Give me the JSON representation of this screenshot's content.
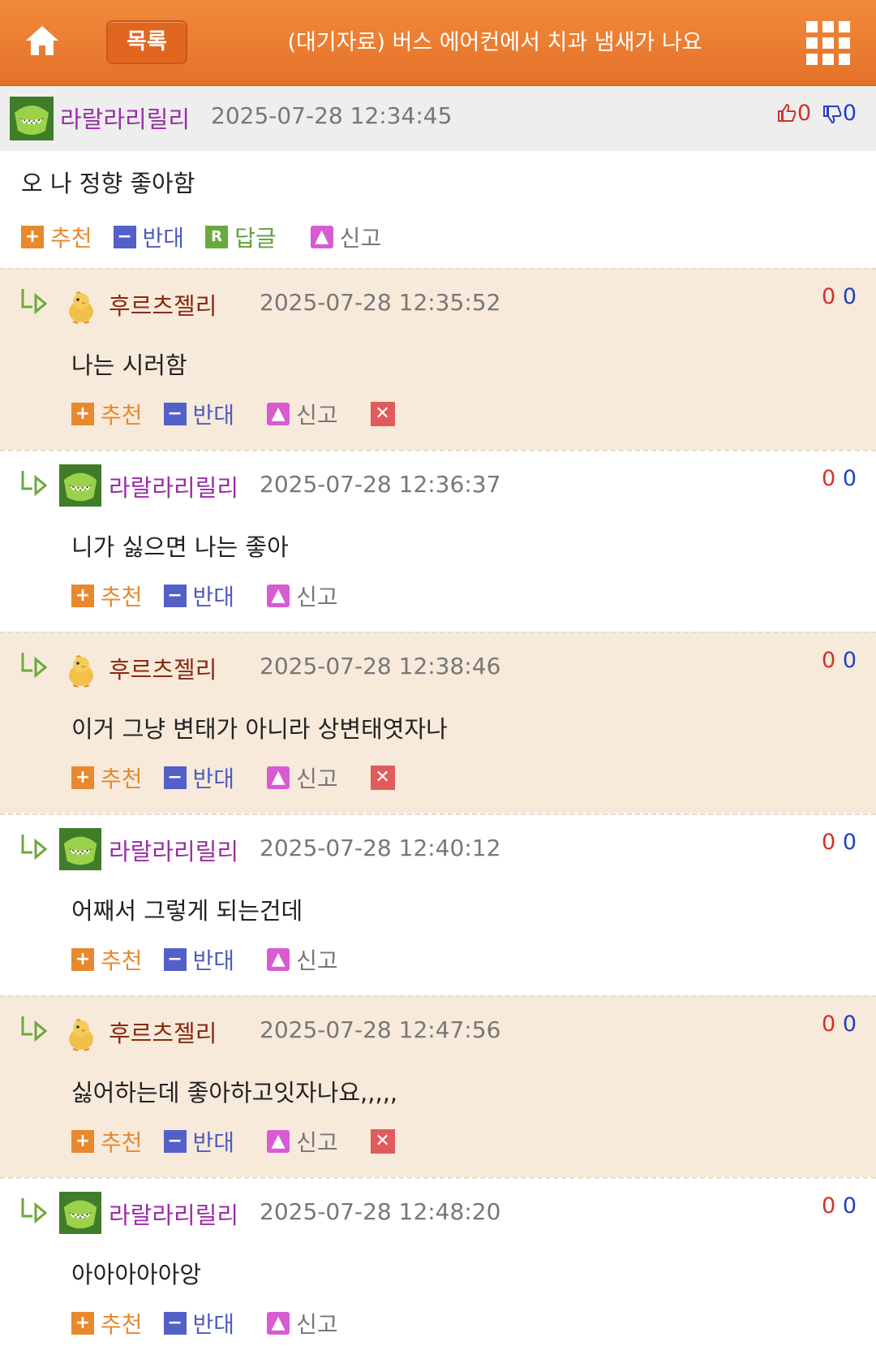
{
  "header": {
    "home_icon": "home-icon",
    "list_label": "목록",
    "title": "(대기자료) 버스 에어컨에서 치과 냄새가 나요",
    "menu_icon": "grid-menu-icon"
  },
  "post": {
    "nickname": "라랄라리릴리",
    "time": "2025-07-28 12:34:45",
    "upvotes": "0",
    "downvotes": "0",
    "text": "오 나 정향 좋아함",
    "actions": {
      "recommend": "추천",
      "oppose": "반대",
      "reply": "답글",
      "report": "신고"
    }
  },
  "comments": [
    {
      "nickname": "후르츠젤리",
      "time": "2025-07-28 12:35:52",
      "up": "0",
      "down": "0",
      "text": "나는 시러함",
      "style": "chick",
      "deletable": true
    },
    {
      "nickname": "라랄라리릴리",
      "time": "2025-07-28 12:36:37",
      "up": "0",
      "down": "0",
      "text": "니가 싫으면 나는 좋아",
      "style": "monster",
      "deletable": false
    },
    {
      "nickname": "후르츠젤리",
      "time": "2025-07-28 12:38:46",
      "up": "0",
      "down": "0",
      "text": "이거 그냥 변태가 아니라 상변태엿자나",
      "style": "chick",
      "deletable": true
    },
    {
      "nickname": "라랄라리릴리",
      "time": "2025-07-28 12:40:12",
      "up": "0",
      "down": "0",
      "text": "어째서 그렇게 되는건데",
      "style": "monster",
      "deletable": false
    },
    {
      "nickname": "후르츠젤리",
      "time": "2025-07-28 12:47:56",
      "up": "0",
      "down": "0",
      "text": "싫어하는데 좋아하고잇자나요,,,,,",
      "style": "chick",
      "deletable": true
    },
    {
      "nickname": "라랄라리릴리",
      "time": "2025-07-28 12:48:20",
      "up": "0",
      "down": "0",
      "text": "아아아아아앙",
      "style": "monster",
      "deletable": false
    }
  ],
  "comment_actions": {
    "recommend": "추천",
    "oppose": "반대",
    "report": "신고"
  },
  "colors": {
    "header_orange": "#e8782e",
    "comment_tan": "#f7eadb",
    "nick_purple": "#9b2ca8",
    "nick_brown": "#8a2a10",
    "vote_red": "#d4302c",
    "vote_blue": "#2340c2"
  }
}
